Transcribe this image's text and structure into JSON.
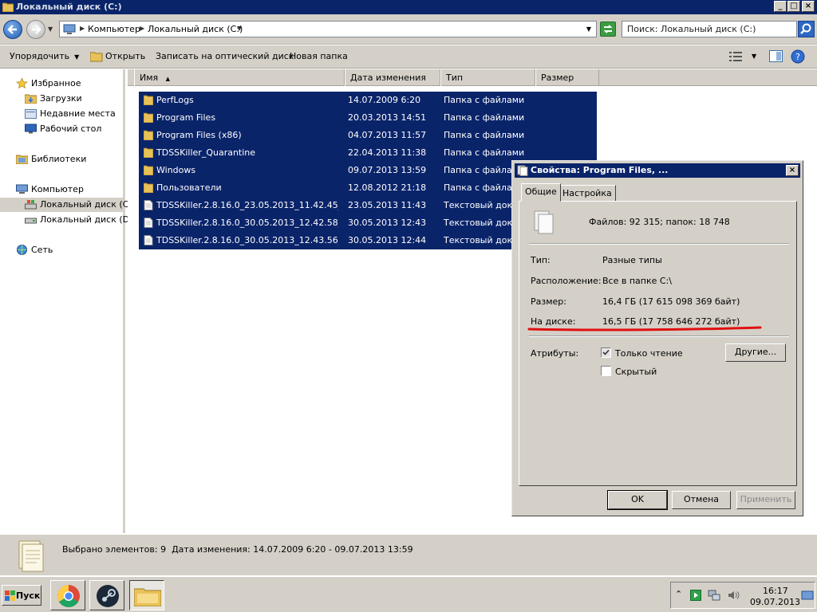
{
  "window": {
    "title": "Локальный диск (C:)"
  },
  "address": {
    "crumbs": [
      "Компьютер",
      "Локальный диск (C:)"
    ],
    "search_placeholder": "Поиск: Локальный диск (C:)"
  },
  "toolbar": {
    "organize": "Упорядочить",
    "open": "Открыть",
    "burn": "Записать на оптический диск",
    "new_folder": "Новая папка"
  },
  "nav": {
    "favorites": "Избранное",
    "downloads": "Загрузки",
    "recent": "Недавние места",
    "desktop": "Рабочий стол",
    "libraries": "Библиотеки",
    "computer": "Компьютер",
    "disk_c": "Локальный диск (C:)",
    "disk_d": "Локальный диск (D:)",
    "network": "Сеть"
  },
  "columns": {
    "name": "Имя",
    "date": "Дата изменения",
    "type": "Тип",
    "size": "Размер"
  },
  "files": [
    {
      "name": "PerfLogs",
      "date": "14.07.2009 6:20",
      "type": "Папка с файлами",
      "kind": "folder"
    },
    {
      "name": "Program Files",
      "date": "20.03.2013 14:51",
      "type": "Папка с файлами",
      "kind": "folder"
    },
    {
      "name": "Program Files (x86)",
      "date": "04.07.2013 11:57",
      "type": "Папка с файлами",
      "kind": "folder"
    },
    {
      "name": "TDSSKiller_Quarantine",
      "date": "22.04.2013 11:38",
      "type": "Папка с файлами",
      "kind": "folder"
    },
    {
      "name": "Windows",
      "date": "09.07.2013 13:59",
      "type": "Папка с файлами",
      "kind": "folder"
    },
    {
      "name": "Пользователи",
      "date": "12.08.2012 21:18",
      "type": "Папка с файлами",
      "kind": "folder"
    },
    {
      "name": "TDSSKiller.2.8.16.0_23.05.2013_11.42.45_l...",
      "date": "23.05.2013 11:43",
      "type": "Текстовый докум",
      "kind": "text"
    },
    {
      "name": "TDSSKiller.2.8.16.0_30.05.2013_12.42.58_l...",
      "date": "30.05.2013 12:43",
      "type": "Текстовый докум",
      "kind": "text"
    },
    {
      "name": "TDSSKiller.2.8.16.0_30.05.2013_12.43.56_l...",
      "date": "30.05.2013 12:44",
      "type": "Текстовый докум",
      "kind": "text"
    }
  ],
  "status": {
    "selected": "Выбрано элементов: 9",
    "date_range": "Дата изменения: 14.07.2009 6:20 - 09.07.2013 13:59"
  },
  "dialog": {
    "title": "Свойства: Program Files, ...",
    "tabs": [
      "Общие",
      "Настройка"
    ],
    "summary": "Файлов: 92 315; папок: 18 748",
    "type_label": "Тип:",
    "type_value": "Разные типы",
    "location_label": "Расположение:",
    "location_value": "Все в папке C:\\",
    "size_label": "Размер:",
    "size_value": "16,4 ГБ (17 615 098 369 байт)",
    "ondisk_label": "На диске:",
    "ondisk_value": "16,5 ГБ (17 758 646 272 байт)",
    "attributes_label": "Атрибуты:",
    "readonly_label": "Только чтение",
    "hidden_label": "Скрытый",
    "other_button": "Другие...",
    "ok": "OK",
    "cancel": "Отмена",
    "apply": "Применить",
    "annotation_color": "#e01010"
  },
  "taskbar": {
    "start": "Пуск",
    "time": "16:17",
    "date": "09.07.2013"
  }
}
